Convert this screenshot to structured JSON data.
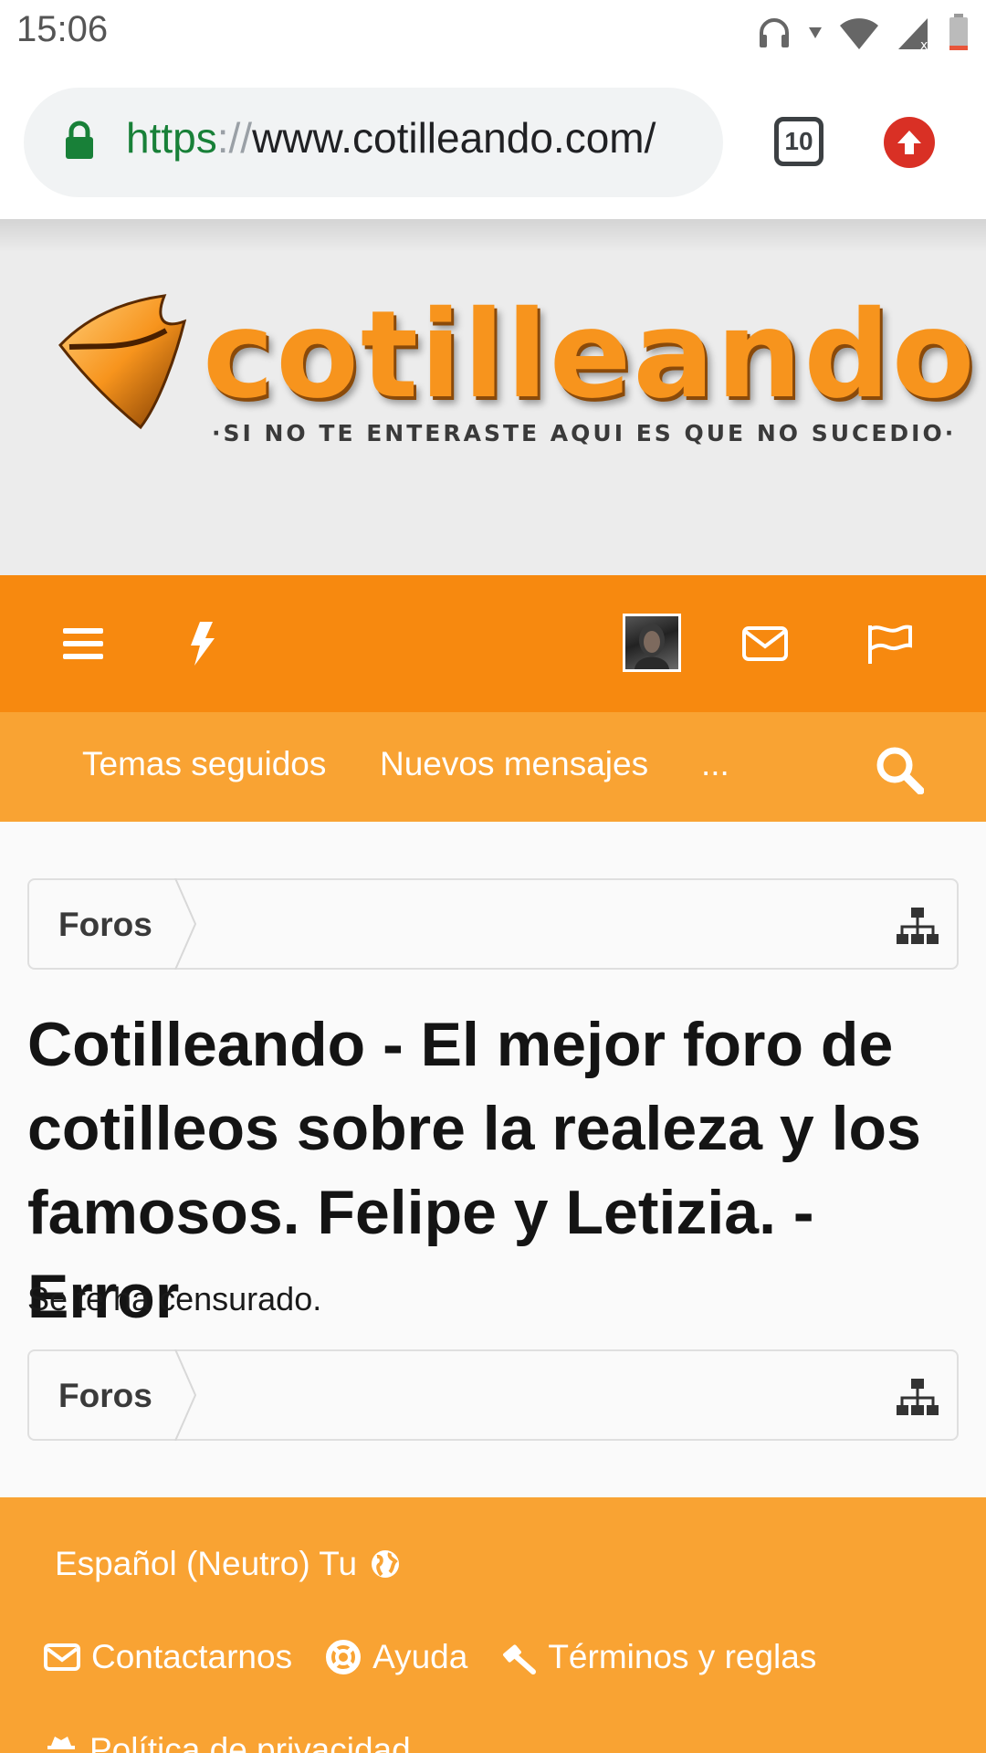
{
  "status_bar": {
    "time": "15:06",
    "icons": [
      "headset-icon",
      "wifi-icon",
      "signal-icon",
      "battery-icon"
    ]
  },
  "browser": {
    "url_scheme": "https",
    "url_sep": "://",
    "url_host": "www.cotilleando.com/",
    "tab_count": "10"
  },
  "banner": {
    "brand": "cotilleando",
    "tagline": "·SI NO TE ENTERASTE AQUI ES QUE NO SUCEDIO·"
  },
  "nav": {
    "icons": [
      "menu-icon",
      "bolt-icon",
      "avatar",
      "envelope-icon",
      "flag-icon"
    ],
    "links": [
      "Temas seguidos",
      "Nuevos mensajes",
      "..."
    ]
  },
  "breadcrumb": {
    "label": "Foros"
  },
  "page": {
    "title": "Cotilleando - El mejor foro de cotilleos sobre la realeza y los famosos. Felipe y Letizia. - Error",
    "message": "Se te ha censurado."
  },
  "footer": {
    "language": "Español (Neutro) Tu",
    "contact": "Contactarnos",
    "help": "Ayuda",
    "terms": "Términos y reglas",
    "privacy": "Política de privacidad"
  },
  "colors": {
    "nav_primary": "#f7890f",
    "nav_secondary": "#f9a333",
    "brand": "#f7941d",
    "update_badge": "#d93025"
  }
}
